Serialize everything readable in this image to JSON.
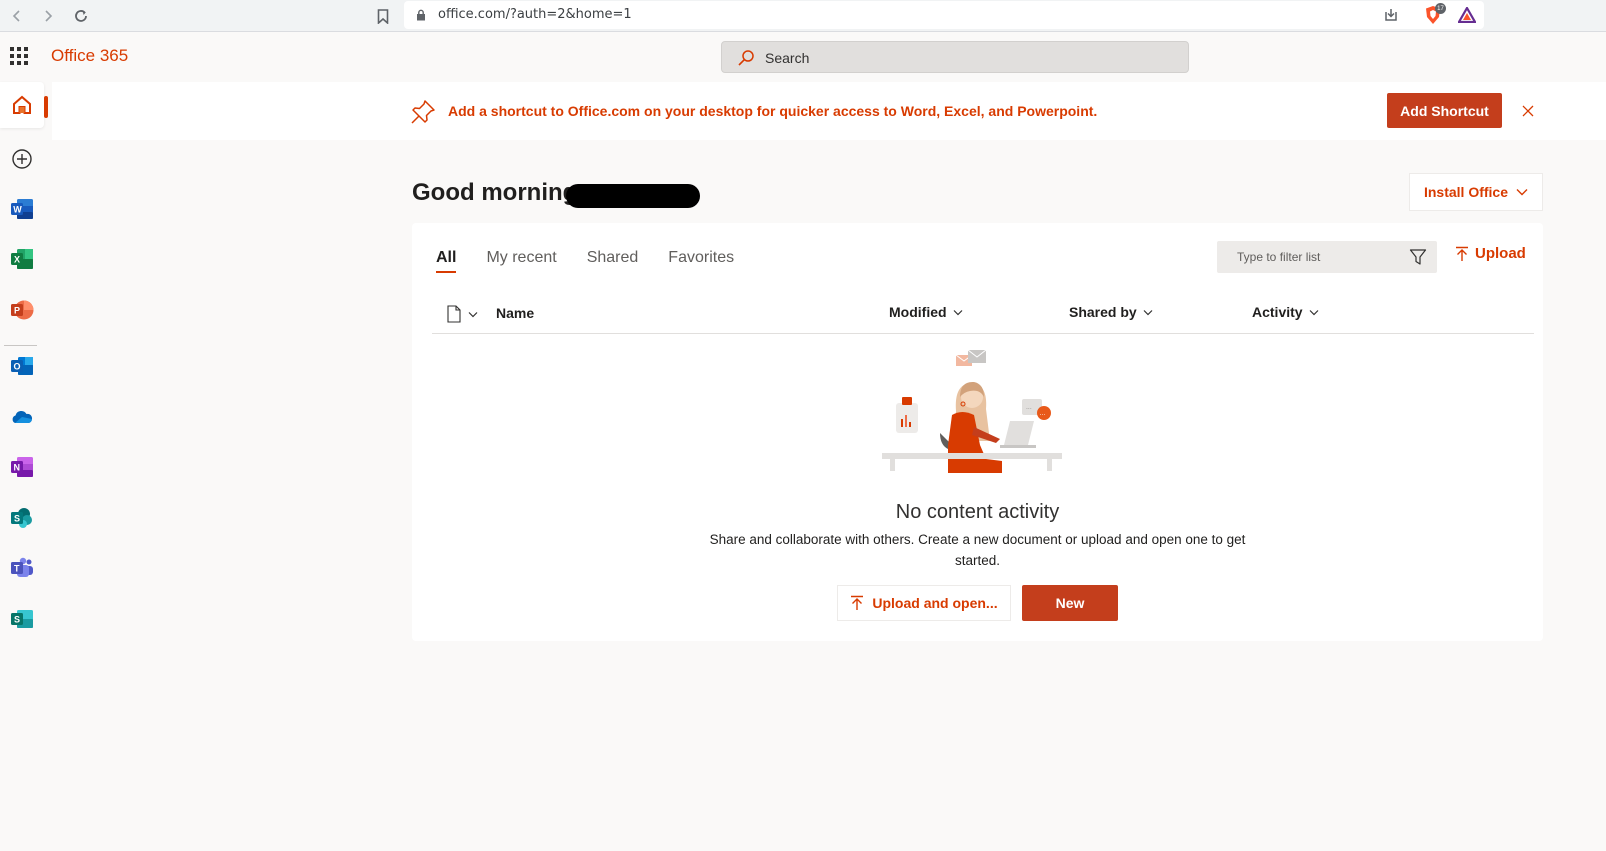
{
  "browser": {
    "url": "office.com/?auth=2&home=1"
  },
  "header": {
    "app_title": "Office 365",
    "search_placeholder": "Search"
  },
  "rail": {
    "items": [
      "home",
      "create",
      "word",
      "excel",
      "powerpoint",
      "outlook",
      "onedrive",
      "onenote",
      "sharepoint",
      "teams",
      "sway"
    ]
  },
  "banner": {
    "message": "Add a shortcut to Office.com on your desktop for quicker access to Word, Excel, and Powerpoint.",
    "button_label": "Add Shortcut"
  },
  "main": {
    "greeting": "Good morning",
    "install_label": "Install Office",
    "tabs": [
      {
        "label": "All"
      },
      {
        "label": "My recent"
      },
      {
        "label": "Shared"
      },
      {
        "label": "Favorites"
      }
    ],
    "filter_placeholder": "Type to filter list",
    "upload_label": "Upload",
    "columns": {
      "name": "Name",
      "modified": "Modified",
      "shared_by": "Shared by",
      "activity": "Activity"
    },
    "empty": {
      "title": "No content activity",
      "description": "Share and collaborate with others. Create a new document or upload and open one to get started.",
      "upload_open_label": "Upload and open...",
      "new_label": "New"
    }
  },
  "colors": {
    "accent": "#d83b01",
    "button": "#c43e1c"
  }
}
